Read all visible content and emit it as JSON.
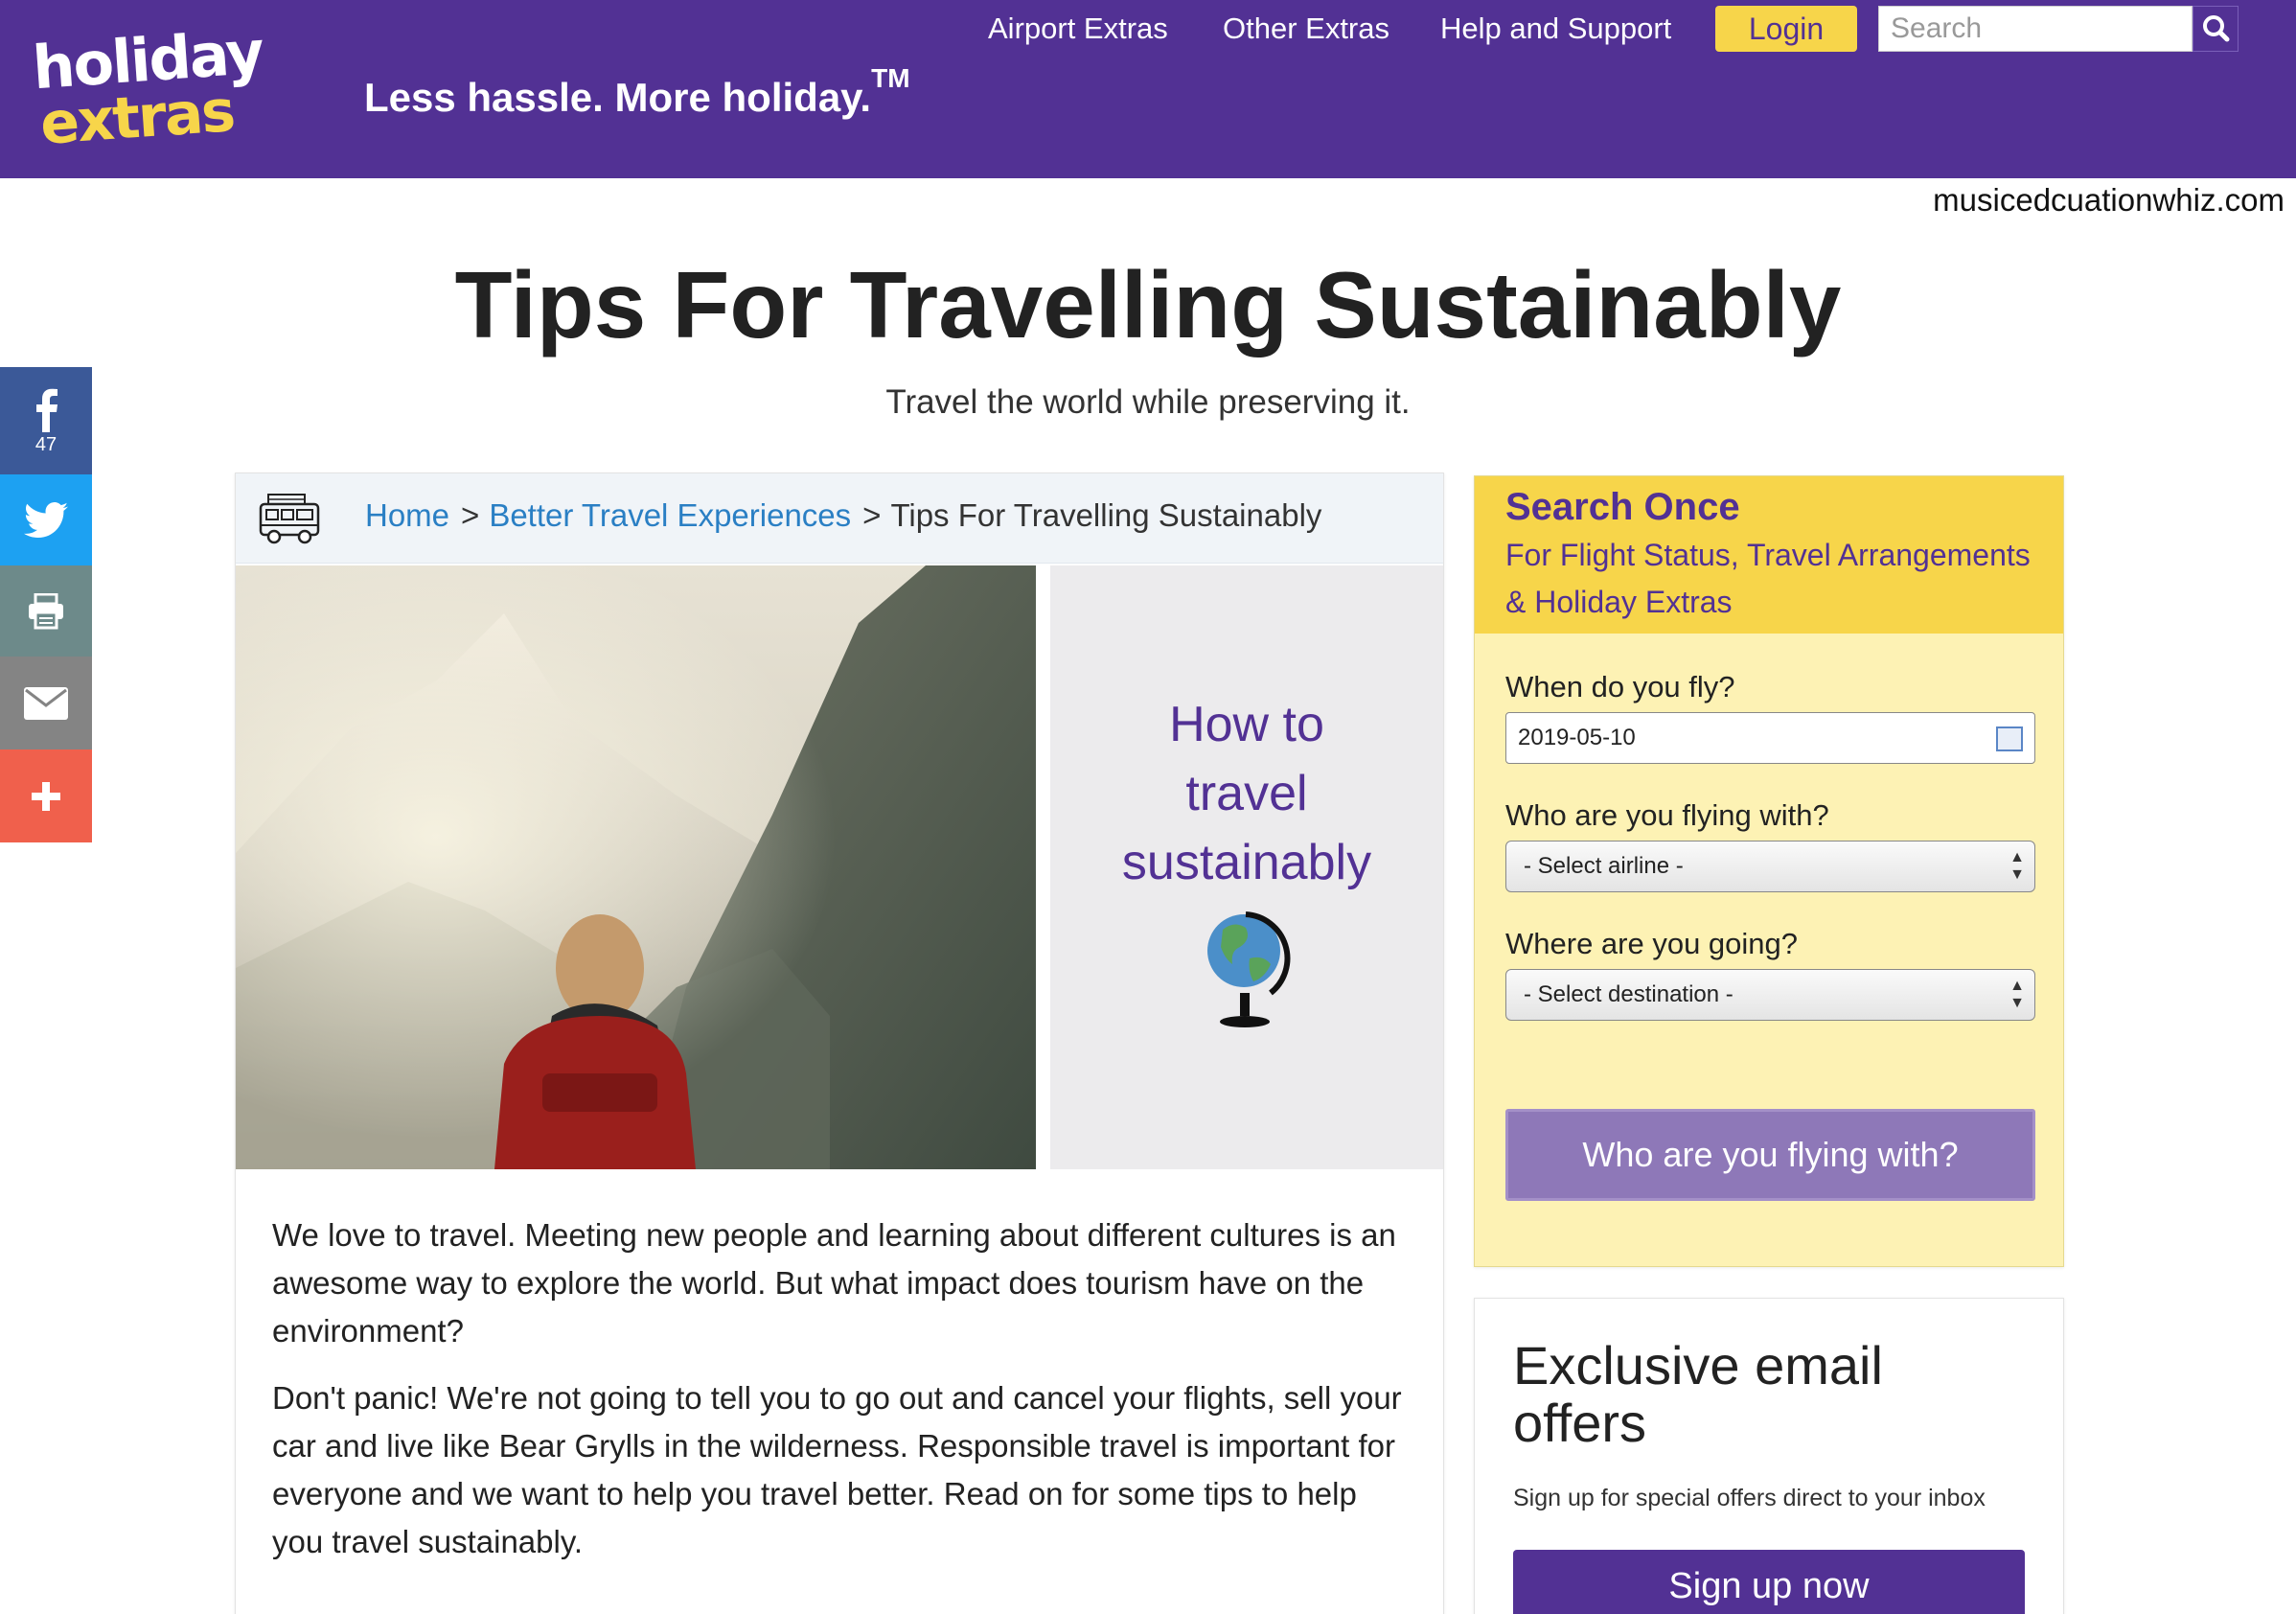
{
  "header": {
    "logo_line1": "holiday",
    "logo_line2": "extras",
    "tagline": "Less hassle. More holiday.",
    "tagline_mark": "TM",
    "nav": {
      "airport_extras": "Airport Extras",
      "other_extras": "Other Extras",
      "help_support": "Help and Support"
    },
    "login_label": "Login",
    "search_placeholder": "Search"
  },
  "watermark": "musicedcuationwhiz.com",
  "page": {
    "title": "Tips For Travelling Sustainably",
    "subtitle": "Travel the world while preserving it."
  },
  "share": {
    "facebook_count": "47"
  },
  "breadcrumb": {
    "home": "Home",
    "sep": ">",
    "category": "Better Travel Experiences",
    "current": "Tips For Travelling Sustainably"
  },
  "hero": {
    "panel_line1": "How to",
    "panel_line2": "travel",
    "panel_line3": "sustainably"
  },
  "article": {
    "paragraph1": "We love to travel. Meeting new people and learning about different cultures is an awesome way to explore the world. But what impact does tourism have on the environment?",
    "paragraph2": "Don't panic! We're not going to tell you to go out and cancel your flights, sell your car and live like Bear Grylls in the wilderness. Responsible travel is important for everyone and we want to help you travel better. Read on for some tips to help you travel sustainably."
  },
  "widget": {
    "title": "Search Once",
    "subtitle": "For Flight Status, Travel Arrangements & Holiday Extras",
    "fly_label": "When do you fly?",
    "fly_value": "2019-05-10",
    "airline_label": "Who are you flying with?",
    "airline_value": "- Select airline -",
    "destination_label": "Where are you going?",
    "destination_value": "- Select destination -",
    "button_label": "Who are you flying with?"
  },
  "offers": {
    "title": "Exclusive email offers",
    "text": "Sign up for special offers direct to your inbox",
    "button_label": "Sign up now"
  },
  "colors": {
    "brand_purple": "#523194",
    "brand_yellow": "#f7d54a",
    "link_blue": "#2a7fc4"
  }
}
